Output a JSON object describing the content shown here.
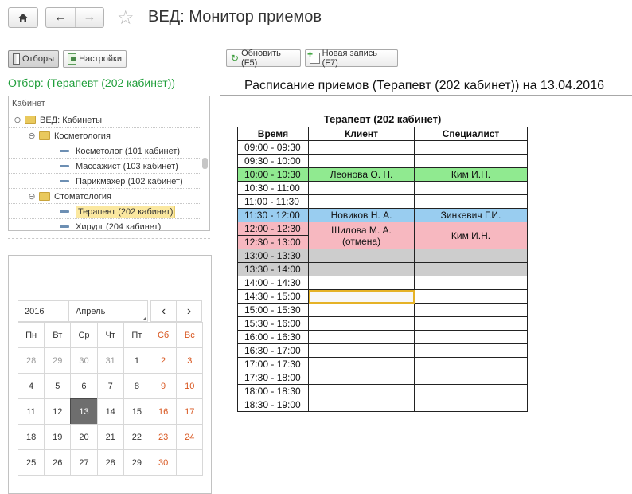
{
  "window": {
    "title": "ВЕД: Монитор приемов"
  },
  "toolbar_left": {
    "filters_label": "Отборы",
    "settings_label": "Настройки"
  },
  "filter": {
    "text": "Отбор: (Терапевт (202 кабинет))",
    "color": "#1f9e3a"
  },
  "tree": {
    "header": "Кабинет",
    "items": [
      {
        "label": "ВЕД: Кабинеты",
        "type": "folder",
        "level": 0
      },
      {
        "label": "Косметология",
        "type": "folder",
        "level": 1
      },
      {
        "label": "Косметолог (101 кабинет)",
        "type": "leaf",
        "level": 2
      },
      {
        "label": "Массажист (103 кабинет)",
        "type": "leaf",
        "level": 2
      },
      {
        "label": "Парикмахер (102 кабинет)",
        "type": "leaf",
        "level": 2
      },
      {
        "label": "Стоматология",
        "type": "folder",
        "level": 1
      },
      {
        "label": "Терапевт (202 кабинет)",
        "type": "leaf",
        "level": 2,
        "selected": true
      },
      {
        "label": "Хирург (204 кабинет)",
        "type": "leaf",
        "level": 2
      }
    ]
  },
  "calendar": {
    "year": "2016",
    "month": "Апрель",
    "prev": "‹",
    "next": "›",
    "weekdays": [
      "Пн",
      "Вт",
      "Ср",
      "Чт",
      "Пт",
      "Сб",
      "Вс"
    ],
    "weeks": [
      [
        "28",
        "29",
        "30",
        "31",
        "1",
        "2",
        "3"
      ],
      [
        "4",
        "5",
        "6",
        "7",
        "8",
        "9",
        "10"
      ],
      [
        "11",
        "12",
        "13",
        "14",
        "15",
        "16",
        "17"
      ],
      [
        "18",
        "19",
        "20",
        "21",
        "22",
        "23",
        "24"
      ],
      [
        "25",
        "26",
        "27",
        "28",
        "29",
        "30",
        ""
      ]
    ],
    "today": "13"
  },
  "toolbar_right": {
    "refresh_label": "Обновить (F5)",
    "new_label": "Новая запись (F7)"
  },
  "schedule": {
    "title": "Расписание приемов (Терапевт (202 кабинет)) на 13.04.2016",
    "grid_title": "Терапевт (202 кабинет)",
    "columns": [
      "Время",
      "Клиент",
      "Специалист"
    ],
    "slots": [
      "09:00 - 09:30",
      "09:30 - 10:00",
      "10:00 - 10:30",
      "10:30 - 11:00",
      "11:00 - 11:30",
      "11:30 - 12:00",
      "12:00 - 12:30",
      "12:30 - 13:00",
      "13:00 - 13:30",
      "13:30 - 14:00",
      "14:00 - 14:30",
      "14:30 - 15:00",
      "15:00 - 15:30",
      "15:30 - 16:00",
      "16:00 - 16:30",
      "16:30 - 17:00",
      "17:00 - 17:30",
      "17:30 - 18:00",
      "18:00 - 18:30",
      "18:30 - 19:00"
    ],
    "appointments": [
      {
        "client": "Леонова О. Н.",
        "specialist": "Ким И.Н.",
        "color": "#90ea90"
      },
      {
        "client": "Новиков Н. А.",
        "specialist": "Зинкевич Г.И.",
        "color": "#99cdf0"
      },
      {
        "client_line1": "Шилова М. А.",
        "client_line2": "(отмена)",
        "specialist": "Ким И.Н.",
        "color": "#f7b8c0"
      }
    ],
    "blocked_color": "#cdcdcd"
  }
}
